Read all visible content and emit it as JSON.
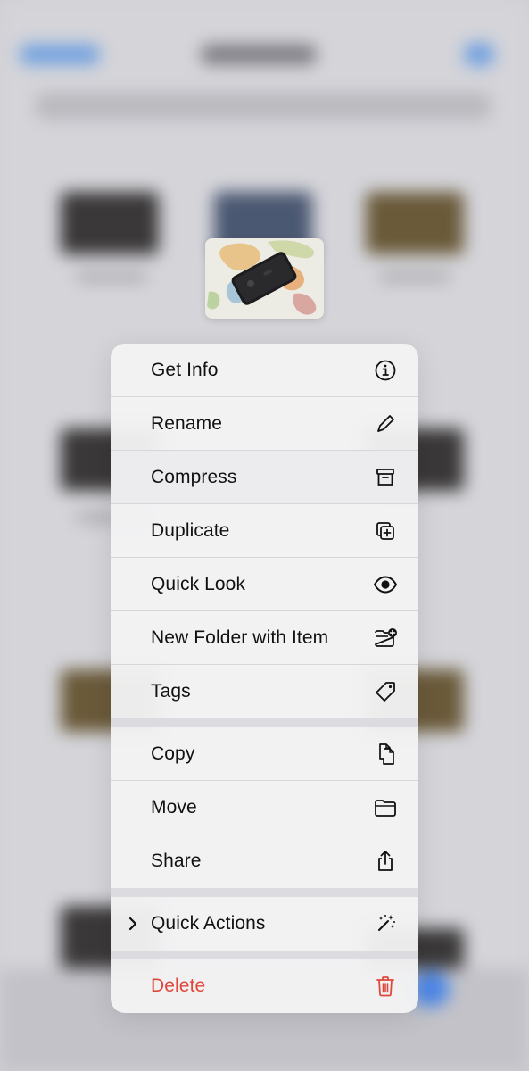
{
  "menu": {
    "groups": [
      [
        {
          "label": "Get Info",
          "icon": "info-icon"
        },
        {
          "label": "Rename",
          "icon": "pencil-icon"
        },
        {
          "label": "Compress",
          "icon": "archive-box-icon"
        },
        {
          "label": "Duplicate",
          "icon": "duplicate-icon"
        },
        {
          "label": "Quick Look",
          "icon": "eye-icon"
        },
        {
          "label": "New Folder with Item",
          "icon": "folder-badge-plus-icon"
        },
        {
          "label": "Tags",
          "icon": "tag-icon"
        }
      ],
      [
        {
          "label": "Copy",
          "icon": "copy-docs-icon"
        },
        {
          "label": "Move",
          "icon": "folder-icon"
        },
        {
          "label": "Share",
          "icon": "share-icon"
        }
      ],
      [
        {
          "label": "Quick Actions",
          "icon": "sparkles-wand-icon",
          "has_submenu": true
        }
      ],
      [
        {
          "label": "Delete",
          "icon": "trash-icon",
          "destructive": true
        }
      ]
    ]
  },
  "colors": {
    "destructive": "#e0473b",
    "accent": "#4a86e8",
    "menu_background": "#f2f2f4"
  }
}
